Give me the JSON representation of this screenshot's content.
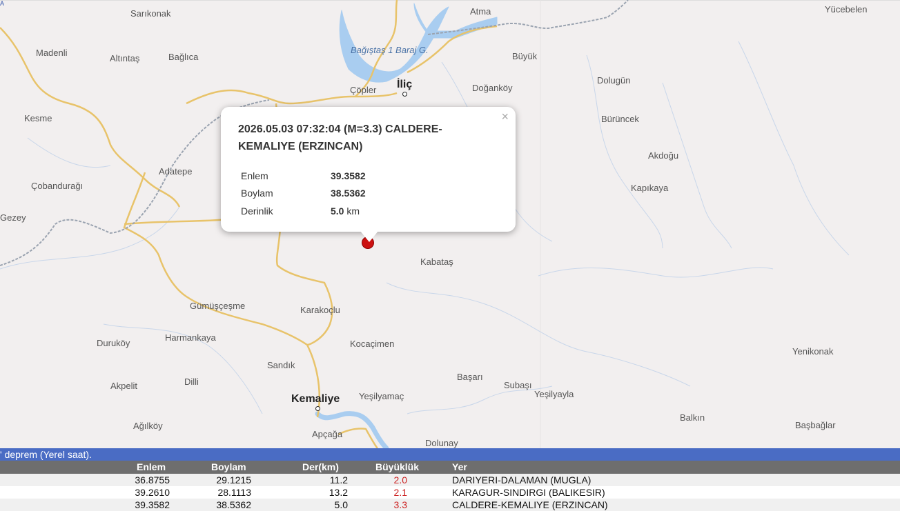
{
  "map": {
    "attribution": "A",
    "places": [
      {
        "name": "Sarıkonak"
      },
      {
        "name": "Madenli"
      },
      {
        "name": "Altıntaş"
      },
      {
        "name": "Bağlıca"
      },
      {
        "name": "Kesme"
      },
      {
        "name": "Adatepe"
      },
      {
        "name": "Çobandurağı"
      },
      {
        "name": "Gezey"
      },
      {
        "name": "Gümüşçeşme"
      },
      {
        "name": "Duruköy"
      },
      {
        "name": "Harmankaya"
      },
      {
        "name": "Sandık"
      },
      {
        "name": "Akpelit"
      },
      {
        "name": "Dilli"
      },
      {
        "name": "Ağılköy"
      },
      {
        "name": "Karakoçlu"
      },
      {
        "name": "Kocaçimen"
      },
      {
        "name": "Yeşilyamaç"
      },
      {
        "name": "Apçağa"
      },
      {
        "name": "Dolunay"
      },
      {
        "name": "Başarı"
      },
      {
        "name": "Subaşı"
      },
      {
        "name": "Yeşilyayla"
      },
      {
        "name": "Balkın"
      },
      {
        "name": "Başbağlar"
      },
      {
        "name": "Yenikonak"
      },
      {
        "name": "Kabataş"
      },
      {
        "name": "Kapıkaya"
      },
      {
        "name": "Akdoğu"
      },
      {
        "name": "Bürüncek"
      },
      {
        "name": "Dolugün"
      },
      {
        "name": "Doğanköy"
      },
      {
        "name": "Büyük"
      },
      {
        "name": "Atma"
      },
      {
        "name": "Yücebelen"
      },
      {
        "name": "Çöpler"
      }
    ],
    "major_places": [
      {
        "name": "İliç"
      },
      {
        "name": "Kemaliye"
      }
    ],
    "water_label": "Bağıştaş 1 Baraj G."
  },
  "popup": {
    "title": "2026.05.03 07:32:04 (M=3.3) CALDERE-KEMALIYE (ERZINCAN)",
    "close": "×",
    "rows": [
      {
        "label": "Enlem",
        "value": "39.3582",
        "unit": ""
      },
      {
        "label": "Boylam",
        "value": "38.5362",
        "unit": ""
      },
      {
        "label": "Derinlik",
        "value": "5.0",
        "unit": "km"
      }
    ]
  },
  "list": {
    "caption": "' deprem (Yerel saat).",
    "headers": {
      "enlem": "Enlem",
      "boylam": "Boylam",
      "der": "Der(km)",
      "mag": "Büyüklük",
      "yer": "Yer"
    },
    "rows": [
      {
        "enlem": "36.8755",
        "boylam": "29.1215",
        "der": "11.2",
        "mag": "2.0",
        "yer": "DARIYERI-DALAMAN (MUGLA)"
      },
      {
        "enlem": "39.2610",
        "boylam": "28.1113",
        "der": "13.2",
        "mag": "2.1",
        "yer": "KARAGUR-SINDIRGI (BALIKESIR)"
      },
      {
        "enlem": "39.3582",
        "boylam": "38.5362",
        "der": "5.0",
        "mag": "3.3",
        "yer": "CALDERE-KEMALIYE (ERZINCAN)"
      }
    ]
  },
  "colors": {
    "road": "#e8c36a",
    "rail": "#9aa3b0",
    "water": "#a9cdf0",
    "marker": "#cc1111",
    "bar": "#4a6cc4",
    "header": "#6e6e6e",
    "magnitude": "#cc2222"
  }
}
